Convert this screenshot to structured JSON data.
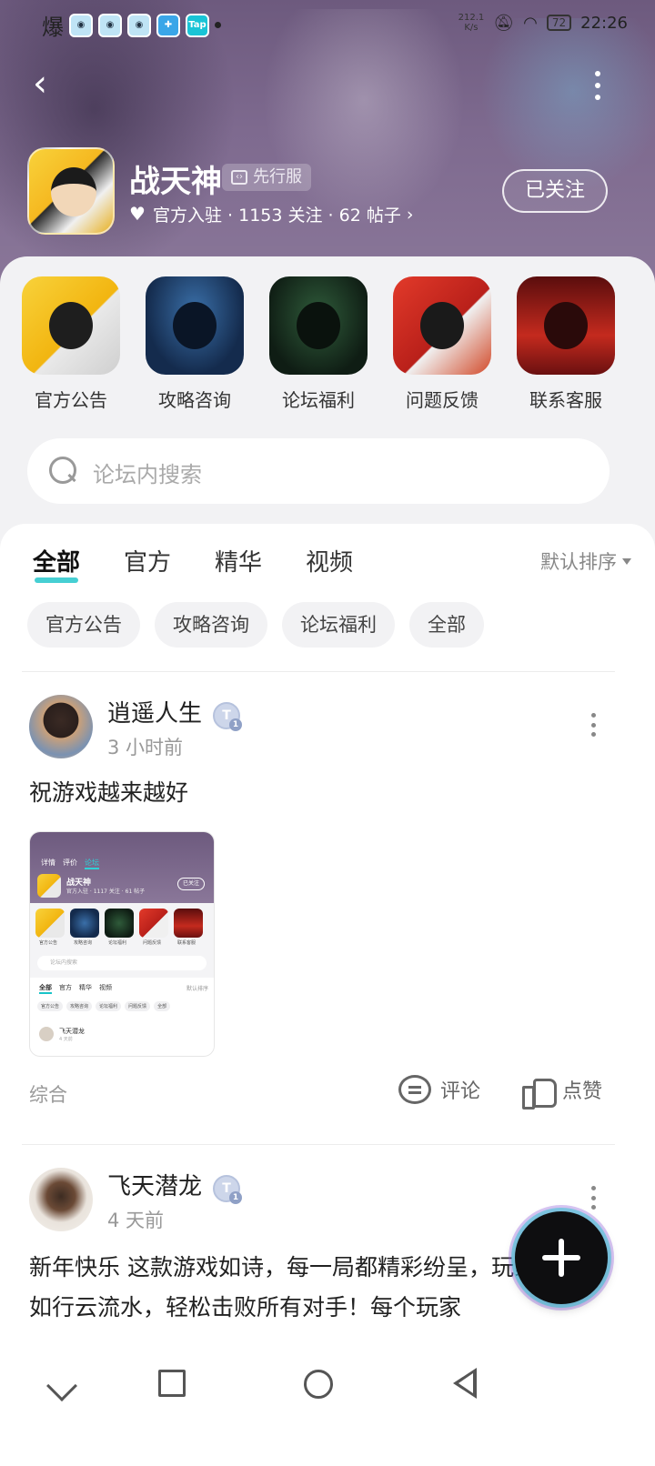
{
  "status_bar": {
    "left_char": "爆",
    "speed": "212.1\nK/s",
    "battery": "72",
    "time": "22:26",
    "tap_label": "Tap"
  },
  "header": {
    "game_title": "战天神",
    "server_tag": "先行服",
    "meta_prefix": "官方入驻 · 1153 关注 · 62 帖子",
    "meta_chevron": "›",
    "follow_label": "已关注",
    "back_glyph": "‹"
  },
  "shortcuts": [
    {
      "label": "官方公告"
    },
    {
      "label": "攻略咨询"
    },
    {
      "label": "论坛福利"
    },
    {
      "label": "问题反馈"
    },
    {
      "label": "联系客服"
    }
  ],
  "search": {
    "placeholder": "论坛内搜索"
  },
  "tabs": [
    {
      "label": "全部",
      "active": true
    },
    {
      "label": "官方"
    },
    {
      "label": "精华"
    },
    {
      "label": "视频"
    }
  ],
  "sort_label": "默认排序",
  "chips": [
    {
      "label": "官方公告"
    },
    {
      "label": "攻略咨询"
    },
    {
      "label": "论坛福利"
    },
    {
      "label": "全部"
    }
  ],
  "posts": [
    {
      "username": "逍遥人生",
      "badge_letter": "T",
      "badge_level": "1",
      "time": "3 小时前",
      "text": "祝游戏越来越好",
      "tag": "综合",
      "comment_label": "评论",
      "like_label": "点赞",
      "thumb": {
        "tabs": [
          "详情",
          "评价",
          "论坛"
        ],
        "title": "战天神",
        "meta": "官方入驻 · 1117 关注 · 61 帖子",
        "follow": "已关注",
        "labels": [
          "官方公告",
          "攻略咨询",
          "论坛福利",
          "问题反馈",
          "联系客服"
        ],
        "search": "论坛内搜索",
        "feed_tabs": [
          "全部",
          "官方",
          "精华",
          "视频"
        ],
        "sort": "默认排序",
        "chips": [
          "官方公告",
          "攻略咨询",
          "论坛福利",
          "问题反馈",
          "全部"
        ],
        "user": "飞天潜龙",
        "user_time": "4 天前"
      }
    },
    {
      "username": "飞天潜龙",
      "badge_letter": "T",
      "badge_level": "1",
      "time": "4 天前",
      "text": "新年快乐  这款游戏如诗，每一局都精彩纷呈，玩家的操作如行云流水，轻松击败所有对手！每个玩家"
    }
  ],
  "colors": {
    "accent": "#18c3c8",
    "banner": "#7e6a8f"
  }
}
